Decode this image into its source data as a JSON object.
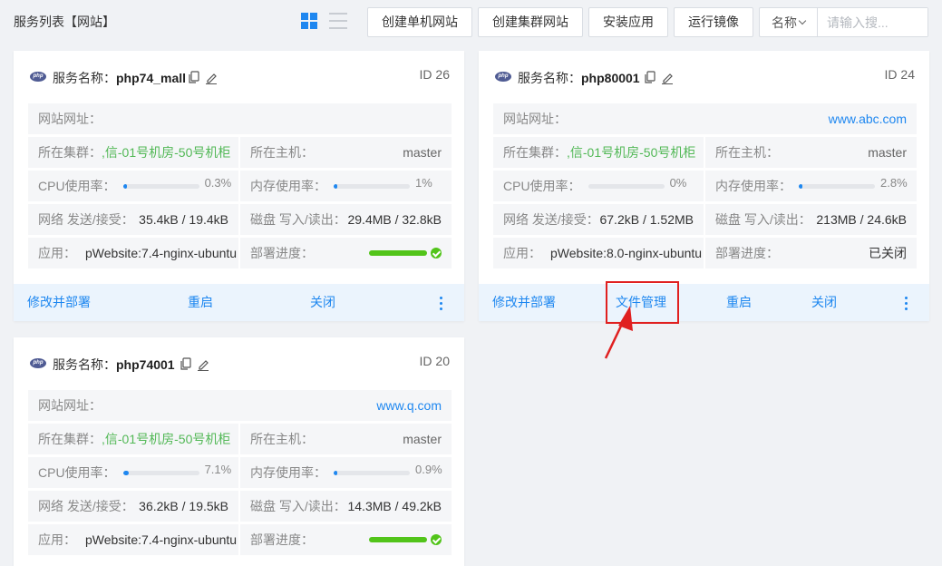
{
  "header": {
    "title": "服务列表【网站】",
    "buttons": {
      "create_single": "创建单机网站",
      "create_cluster": "创建集群网站",
      "install_app": "安装应用",
      "run_image": "运行镜像"
    },
    "search": {
      "field": "名称",
      "placeholder": "请输入搜..."
    }
  },
  "labels": {
    "service_name": "服务名称：",
    "url": "网站网址：",
    "cluster": "所在集群：",
    "host": "所在主机：",
    "cpu": "CPU使用率：",
    "mem": "内存使用率：",
    "net": "网络 发送/接受：",
    "disk": "磁盘 写入/读出：",
    "app": "应用：",
    "deploy": "部署进度："
  },
  "cards": [
    {
      "name": "php74_mall",
      "id": "ID 26",
      "url": "",
      "cluster": ",信-01号机房-50号机柜",
      "host": "master",
      "cpu": "0.3%",
      "cpu_fraction": 0.003,
      "mem": "1%",
      "mem_fraction": 0.01,
      "net": "35.4kB / 19.4kB",
      "disk": "29.4MB / 32.8kB",
      "app": "pWebsite:7.4-nginx-ubuntu",
      "deploy_status": "",
      "deploy_progress": 1,
      "actions": {
        "modify": "修改并部署",
        "file": "",
        "restart": "重启",
        "close": "关闭"
      }
    },
    {
      "name": "php80001",
      "id": "ID 24",
      "url": "www.abc.com",
      "cluster": ",信-01号机房-50号机柜",
      "host": "master",
      "cpu": "0%",
      "cpu_fraction": 0,
      "mem": "2.8%",
      "mem_fraction": 0.028,
      "net": "67.2kB / 1.52MB",
      "disk": "213MB / 24.6kB",
      "app": "pWebsite:8.0-nginx-ubuntu",
      "deploy_status": "已关闭",
      "deploy_progress": null,
      "actions": {
        "modify": "修改并部署",
        "file": "文件管理",
        "restart": "重启",
        "close": "关闭"
      }
    },
    {
      "name": "php74001",
      "id": "ID 20",
      "url": "www.q.com",
      "cluster": ",信-01号机房-50号机柜",
      "host": "master",
      "cpu": "7.1%",
      "cpu_fraction": 0.071,
      "mem": "0.9%",
      "mem_fraction": 0.009,
      "net": "36.2kB / 19.5kB",
      "disk": "14.3MB / 49.2kB",
      "app": "pWebsite:7.4-nginx-ubuntu",
      "deploy_status": "",
      "deploy_progress": 1,
      "actions": {
        "modify": "",
        "file": "",
        "restart": "",
        "close": ""
      }
    }
  ],
  "colors": {
    "accent": "#1e87f0",
    "success": "#52c41a",
    "cluster_green": "#52b856",
    "highlight": "#e02020"
  }
}
